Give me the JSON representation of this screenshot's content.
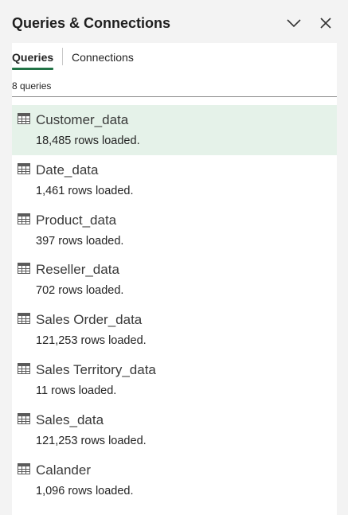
{
  "pane": {
    "title": "Queries & Connections"
  },
  "tabs": [
    {
      "label": "Queries",
      "active": true
    },
    {
      "label": "Connections",
      "active": false
    }
  ],
  "query_count_label": "8 queries",
  "queries": [
    {
      "name": "Customer_data",
      "rows": "18,485 rows loaded.",
      "selected": true
    },
    {
      "name": "Date_data",
      "rows": "1,461 rows loaded."
    },
    {
      "name": "Product_data",
      "rows": "397 rows loaded."
    },
    {
      "name": "Reseller_data",
      "rows": "702 rows loaded."
    },
    {
      "name": "Sales Order_data",
      "rows": "121,253 rows loaded."
    },
    {
      "name": "Sales Territory_data",
      "rows": "11 rows loaded."
    },
    {
      "name": "Sales_data",
      "rows": "121,253 rows loaded."
    },
    {
      "name": "Calander",
      "rows": "1,096 rows loaded."
    }
  ],
  "colors": {
    "accent": "#217346",
    "selected_row": "#e5f2e9",
    "table_icon": "#5a5a5a"
  },
  "icons": {
    "collapse": "chevron-down-icon",
    "close": "close-icon",
    "query": "table-icon"
  }
}
